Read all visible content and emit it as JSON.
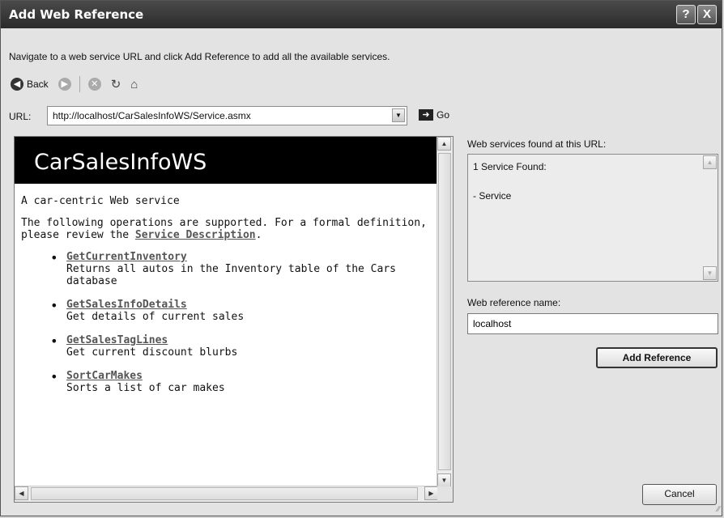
{
  "window": {
    "title": "Add Web Reference",
    "help_glyph": "?",
    "close_glyph": "X"
  },
  "instructions": "Navigate to a web service URL and click Add Reference to add all the available services.",
  "nav": {
    "back_label": "Back"
  },
  "url": {
    "label": "URL:",
    "value": "http://localhost/CarSalesInfoWS/Service.asmx",
    "go_label": "Go"
  },
  "browser": {
    "service_title": "CarSalesInfoWS",
    "description": "A car-centric Web service",
    "ops_intro": "The following operations are supported. For a formal definition, please review the",
    "service_description_link": "Service Description",
    "ops_intro_end": ".",
    "operations": [
      {
        "name": "GetCurrentInventory",
        "description": "Returns all autos in the Inventory table of the Cars database"
      },
      {
        "name": "GetSalesInfoDetails",
        "description": "Get details of current sales"
      },
      {
        "name": "GetSalesTagLines",
        "description": "Get current discount blurbs"
      },
      {
        "name": "SortCarMakes",
        "description": "Sorts a list of car makes"
      }
    ]
  },
  "services_found": {
    "label": "Web services found at this URL:",
    "lines": [
      "1 Service Found:",
      "- Service"
    ]
  },
  "reference_name": {
    "label": "Web reference name:",
    "value": "localhost"
  },
  "buttons": {
    "add_reference": "Add Reference",
    "cancel": "Cancel"
  }
}
